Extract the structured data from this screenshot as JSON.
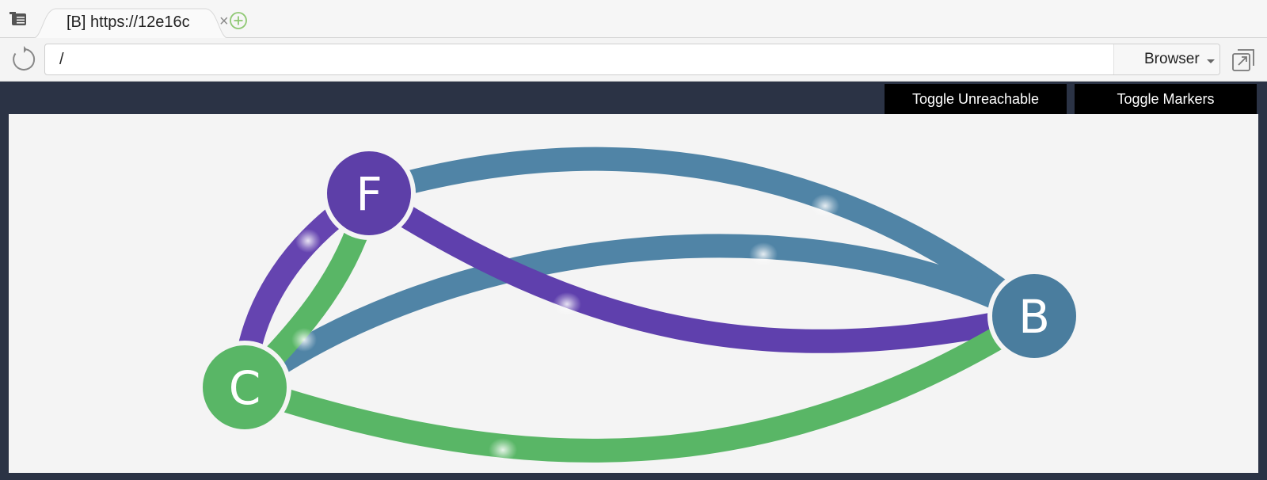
{
  "browser": {
    "tab_title": "[B] https://12e16c",
    "tab_close": "×",
    "url": "/",
    "mode_select": "Browser",
    "icons": [
      "menu-icon",
      "close-icon",
      "new-tab-icon",
      "reload-icon",
      "chevron-down-icon",
      "popout-icon"
    ]
  },
  "app": {
    "buttons": {
      "toggle_unreachable": "Toggle Unreachable",
      "toggle_markers": "Toggle Markers"
    },
    "graph": {
      "nodes": [
        {
          "id": "F",
          "label": "F",
          "color": "#5d3fa8"
        },
        {
          "id": "B",
          "label": "B",
          "color": "#4a7d9e"
        },
        {
          "id": "C",
          "label": "C",
          "color": "#59b666"
        }
      ],
      "edges": [
        {
          "from": "F",
          "to": "B",
          "color": "#5084a6"
        },
        {
          "from": "C",
          "to": "B",
          "color": "#5084a6"
        },
        {
          "from": "F",
          "to": "B",
          "color": "#5d3fa8"
        },
        {
          "from": "F",
          "to": "C",
          "color": "#6544b0"
        },
        {
          "from": "F",
          "to": "C",
          "color": "#59b666"
        },
        {
          "from": "C",
          "to": "B",
          "color": "#59b666"
        }
      ],
      "background": "#f4f4f4"
    }
  }
}
